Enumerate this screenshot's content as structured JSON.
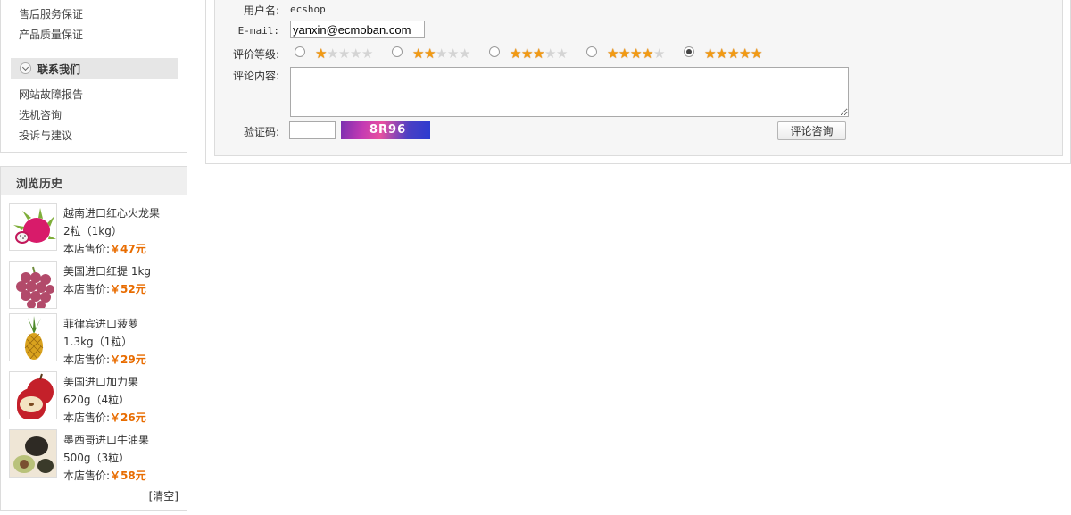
{
  "sidebar": {
    "help_links": [
      "售后服务保证",
      "产品质量保证"
    ],
    "contact": {
      "title": "联系我们",
      "links": [
        "网站故障报告",
        "选机咨询",
        "投诉与建议"
      ]
    }
  },
  "history": {
    "title": "浏览历史",
    "price_label": "本店售价:",
    "items": [
      {
        "name": "越南进口红心火龙果",
        "spec": "2粒（1kg）",
        "price": "￥47元",
        "image": "dragon-fruit"
      },
      {
        "name": "美国进口红提 1kg",
        "spec": "",
        "price": "￥52元",
        "image": "red-grapes"
      },
      {
        "name": "菲律宾进口菠萝",
        "spec": "1.3kg（1粒）",
        "price": "￥29元",
        "image": "pineapple"
      },
      {
        "name": "美国进口加力果",
        "spec": "620g（4粒）",
        "price": "￥26元",
        "image": "apples"
      },
      {
        "name": "墨西哥进口牛油果",
        "spec": "500g（3粒）",
        "price": "￥58元",
        "image": "avocado"
      }
    ],
    "clear_label": "[清空]"
  },
  "comment_form": {
    "username_label": "用户名:",
    "username_value": "ecshop",
    "email_label": "E-mail:",
    "email_value": "yanxin@ecmoban.com",
    "rank_label": "评价等级:",
    "rank_options": [
      1,
      2,
      3,
      4,
      5
    ],
    "rank_selected": 5,
    "content_label": "评论内容:",
    "content_value": "",
    "captcha_label": "验证码:",
    "captcha_text": "8R96",
    "submit_label": "评论咨询"
  },
  "colors": {
    "price": "#e86c00",
    "star_on": "#f29a12",
    "star_off": "#d4d4d4"
  }
}
